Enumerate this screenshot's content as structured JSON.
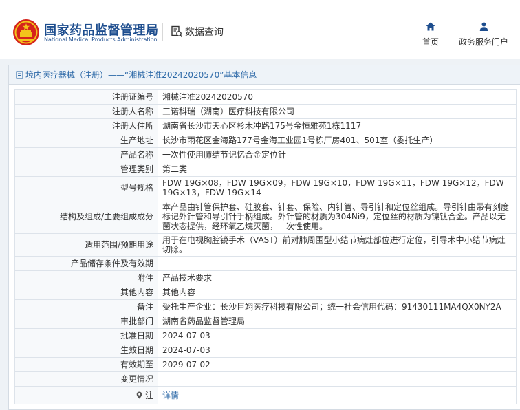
{
  "header": {
    "brand_cn": "国家药品监督管理局",
    "brand_en": "National Medical Products Administration",
    "query_label": "数据查询",
    "nav_home": "首页",
    "nav_gov": "政务服务门户"
  },
  "breadcrumb": "境内医疗器械（注册）——“湘械注准20242020570”基本信息",
  "rows": [
    {
      "key": "注册证编号",
      "value": "湘械注准20242020570"
    },
    {
      "key": "注册人名称",
      "value": "三诺科瑞（湖南）医疗科技有限公司"
    },
    {
      "key": "注册人住所",
      "value": "湖南省长沙市天心区杉木冲路175号金恒雅苑1栋1117"
    },
    {
      "key": "生产地址",
      "value": "长沙市雨花区金海路177号金海工业园1号栋厂房401、501室（委托生产）"
    },
    {
      "key": "产品名称",
      "value": "一次性使用肺结节记忆合金定位针"
    },
    {
      "key": "管理类别",
      "value": "第二类"
    },
    {
      "key": "型号规格",
      "value": "FDW 19G×08，FDW 19G×09，FDW 19G×10，FDW 19G×11，FDW 19G×12，FDW 19G×13，FDW 19G×14"
    },
    {
      "key": "结构及组成/主要组成成分",
      "value": "本产品由针管保护套、硅胶套、针套、保险、内针管、导引针和定位丝组成。导引针由带有刻度标记外针管和导引针手柄组成。外针管的材质为304Ni9，定位丝的材质为镍钛合金。产品以无菌状态提供，经环氧乙烷灭菌，一次性使用。"
    },
    {
      "key": "适用范围/预期用途",
      "value": "用于在电视胸腔镜手术（VAST）前对肺周围型小结节病灶部位进行定位，引导术中小结节病灶切除。"
    },
    {
      "key": "产品储存条件及有效期",
      "value": ""
    },
    {
      "key": "附件",
      "value": "产品技术要求"
    },
    {
      "key": "其他内容",
      "value": "其他内容"
    },
    {
      "key": "备注",
      "value": "受托生产企业：长沙巨翊医疗科技有限公司；统一社会信用代码：91430111MA4QX0NY2A"
    },
    {
      "key": "审批部门",
      "value": "湖南省药品监督管理局"
    },
    {
      "key": "批准日期",
      "value": "2024-07-03"
    },
    {
      "key": "生效日期",
      "value": "2024-07-03"
    },
    {
      "key": "有效期至",
      "value": "2029-07-02"
    },
    {
      "key": "变更情况",
      "value": ""
    },
    {
      "key": "注",
      "value": "详情"
    }
  ],
  "colors": {
    "brand": "#1d4d8e",
    "link": "#2e6aa8",
    "emblem_red": "#d5231c",
    "emblem_gold": "#f3c21b"
  },
  "icons": [
    "national-emblem-icon",
    "search-document-icon",
    "home-icon",
    "user-icon",
    "location-pin-icon",
    "document-icon"
  ]
}
